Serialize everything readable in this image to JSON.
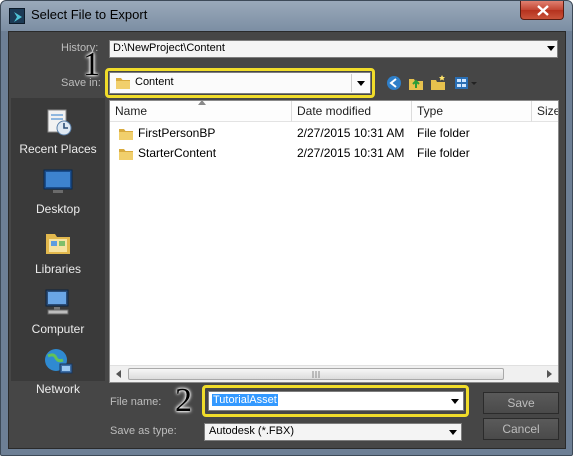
{
  "window": {
    "title": "Select File to Export"
  },
  "history": {
    "label": "History:",
    "value": "D:\\NewProject\\Content"
  },
  "save_in": {
    "label": "Save in:",
    "value": "Content"
  },
  "places": [
    {
      "label": "Recent Places",
      "icon": "recent-places-icon"
    },
    {
      "label": "Desktop",
      "icon": "desktop-icon"
    },
    {
      "label": "Libraries",
      "icon": "libraries-icon"
    },
    {
      "label": "Computer",
      "icon": "computer-icon"
    },
    {
      "label": "Network",
      "icon": "network-icon"
    }
  ],
  "columns": [
    "Name",
    "Date modified",
    "Type",
    "Size"
  ],
  "files": [
    {
      "name": "FirstPersonBP",
      "date": "2/27/2015 10:31 AM",
      "type": "File folder"
    },
    {
      "name": "StarterContent",
      "date": "2/27/2015 10:31 AM",
      "type": "File folder"
    }
  ],
  "file_name": {
    "label": "File name:",
    "value": "TutorialAsset"
  },
  "save_as_type": {
    "label": "Save as type:",
    "value": "Autodesk (*.FBX)"
  },
  "buttons": {
    "save": "Save",
    "cancel": "Cancel"
  },
  "annotations": {
    "callout_1": "1",
    "callout_2": "2",
    "highlight_color": "#f0dc2a"
  },
  "colors": {
    "dialog_bg": "#464646",
    "selection": "#3399ff",
    "folder": "#e8c25a"
  }
}
